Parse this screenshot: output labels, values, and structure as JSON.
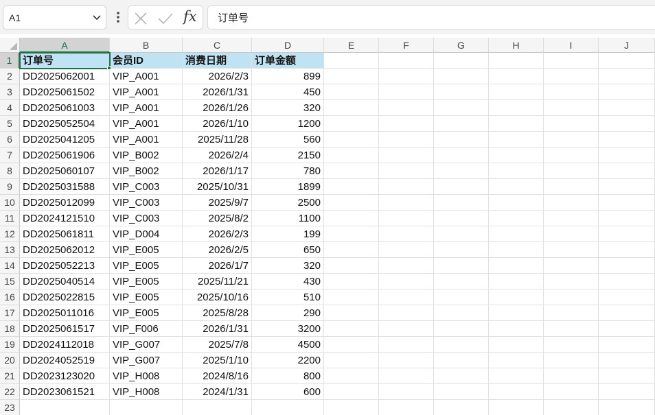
{
  "namebox": {
    "value": "A1"
  },
  "formula": {
    "fx_label": "fx",
    "value": "订单号"
  },
  "columns": [
    "A",
    "B",
    "C",
    "D",
    "E",
    "F",
    "G",
    "H",
    "I",
    "J"
  ],
  "header_row": [
    "订单号",
    "会员ID",
    "消费日期",
    "订单金额"
  ],
  "rows": [
    [
      "DD2025062001",
      "VIP_A001",
      "2026/2/3",
      "899"
    ],
    [
      "DD2025061502",
      "VIP_A001",
      "2026/1/31",
      "450"
    ],
    [
      "DD2025061003",
      "VIP_A001",
      "2026/1/26",
      "320"
    ],
    [
      "DD2025052504",
      "VIP_A001",
      "2026/1/10",
      "1200"
    ],
    [
      "DD2025041205",
      "VIP_A001",
      "2025/11/28",
      "560"
    ],
    [
      "DD2025061906",
      "VIP_B002",
      "2026/2/4",
      "2150"
    ],
    [
      "DD2025060107",
      "VIP_B002",
      "2026/1/17",
      "780"
    ],
    [
      "DD2025031588",
      "VIP_C003",
      "2025/10/31",
      "1899"
    ],
    [
      "DD2025012099",
      "VIP_C003",
      "2025/9/7",
      "2500"
    ],
    [
      "DD2024121510",
      "VIP_C003",
      "2025/8/2",
      "1100"
    ],
    [
      "DD2025061811",
      "VIP_D004",
      "2026/2/3",
      "199"
    ],
    [
      "DD2025062012",
      "VIP_E005",
      "2026/2/5",
      "650"
    ],
    [
      "DD2025052213",
      "VIP_E005",
      "2026/1/7",
      "320"
    ],
    [
      "DD2025040514",
      "VIP_E005",
      "2025/11/21",
      "430"
    ],
    [
      "DD2025022815",
      "VIP_E005",
      "2025/10/16",
      "510"
    ],
    [
      "DD2025011016",
      "VIP_E005",
      "2025/8/28",
      "290"
    ],
    [
      "DD2025061517",
      "VIP_F006",
      "2026/1/31",
      "3200"
    ],
    [
      "DD2024112018",
      "VIP_G007",
      "2025/7/8",
      "4500"
    ],
    [
      "DD2024052519",
      "VIP_G007",
      "2025/1/10",
      "2200"
    ],
    [
      "DD2023123020",
      "VIP_H008",
      "2024/8/16",
      "800"
    ],
    [
      "DD2023061521",
      "VIP_H008",
      "2024/1/31",
      "600"
    ]
  ],
  "row_numbers": [
    "1",
    "2",
    "3",
    "4",
    "5",
    "6",
    "7",
    "8",
    "9",
    "10",
    "11",
    "12",
    "13",
    "14",
    "15",
    "16",
    "17",
    "18",
    "19",
    "20",
    "21",
    "22",
    "23"
  ],
  "selected_cell": "A1",
  "colors": {
    "accent": "#217346",
    "header_fill": "#bfe3f2"
  }
}
